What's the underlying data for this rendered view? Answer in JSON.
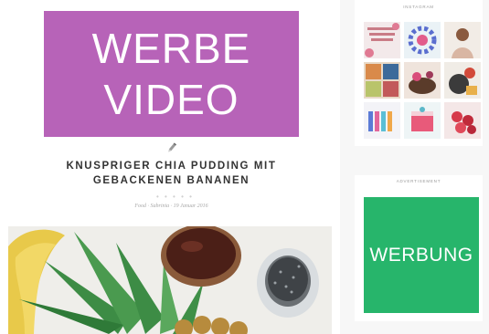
{
  "post": {
    "promo_line1": "WERBE",
    "promo_line2": "VIDEO",
    "title_line1": "KNUSPRIGER CHIA PUDDING MIT",
    "title_line2": "GEBACKENEN BANANEN",
    "divider": "• • • • •",
    "meta": "Food · Sabrinia · 19 Januar 2016",
    "promo_color": "#b763b8"
  },
  "sidebar": {
    "instagram_title": "INSTAGRAM",
    "instagram_tiles": [
      {
        "name": "instagram-tile-quote",
        "color": "#f3e9ea"
      },
      {
        "name": "instagram-tile-pencils",
        "color": "#eaf2f6"
      },
      {
        "name": "instagram-tile-portrait",
        "color": "#f2ece6"
      },
      {
        "name": "instagram-tile-collage",
        "color": "#e8d9c7"
      },
      {
        "name": "instagram-tile-food",
        "color": "#efe4dc"
      },
      {
        "name": "instagram-tile-fruit",
        "color": "#f0ece6"
      },
      {
        "name": "instagram-tile-books",
        "color": "#f3f3f7"
      },
      {
        "name": "instagram-tile-cake",
        "color": "#eef5f6"
      },
      {
        "name": "instagram-tile-berries",
        "color": "#f4e7e7"
      }
    ],
    "ad_title": "ADVERTISEMENT",
    "ad_label": "WERBUNG",
    "ad_color": "#27b56b"
  }
}
